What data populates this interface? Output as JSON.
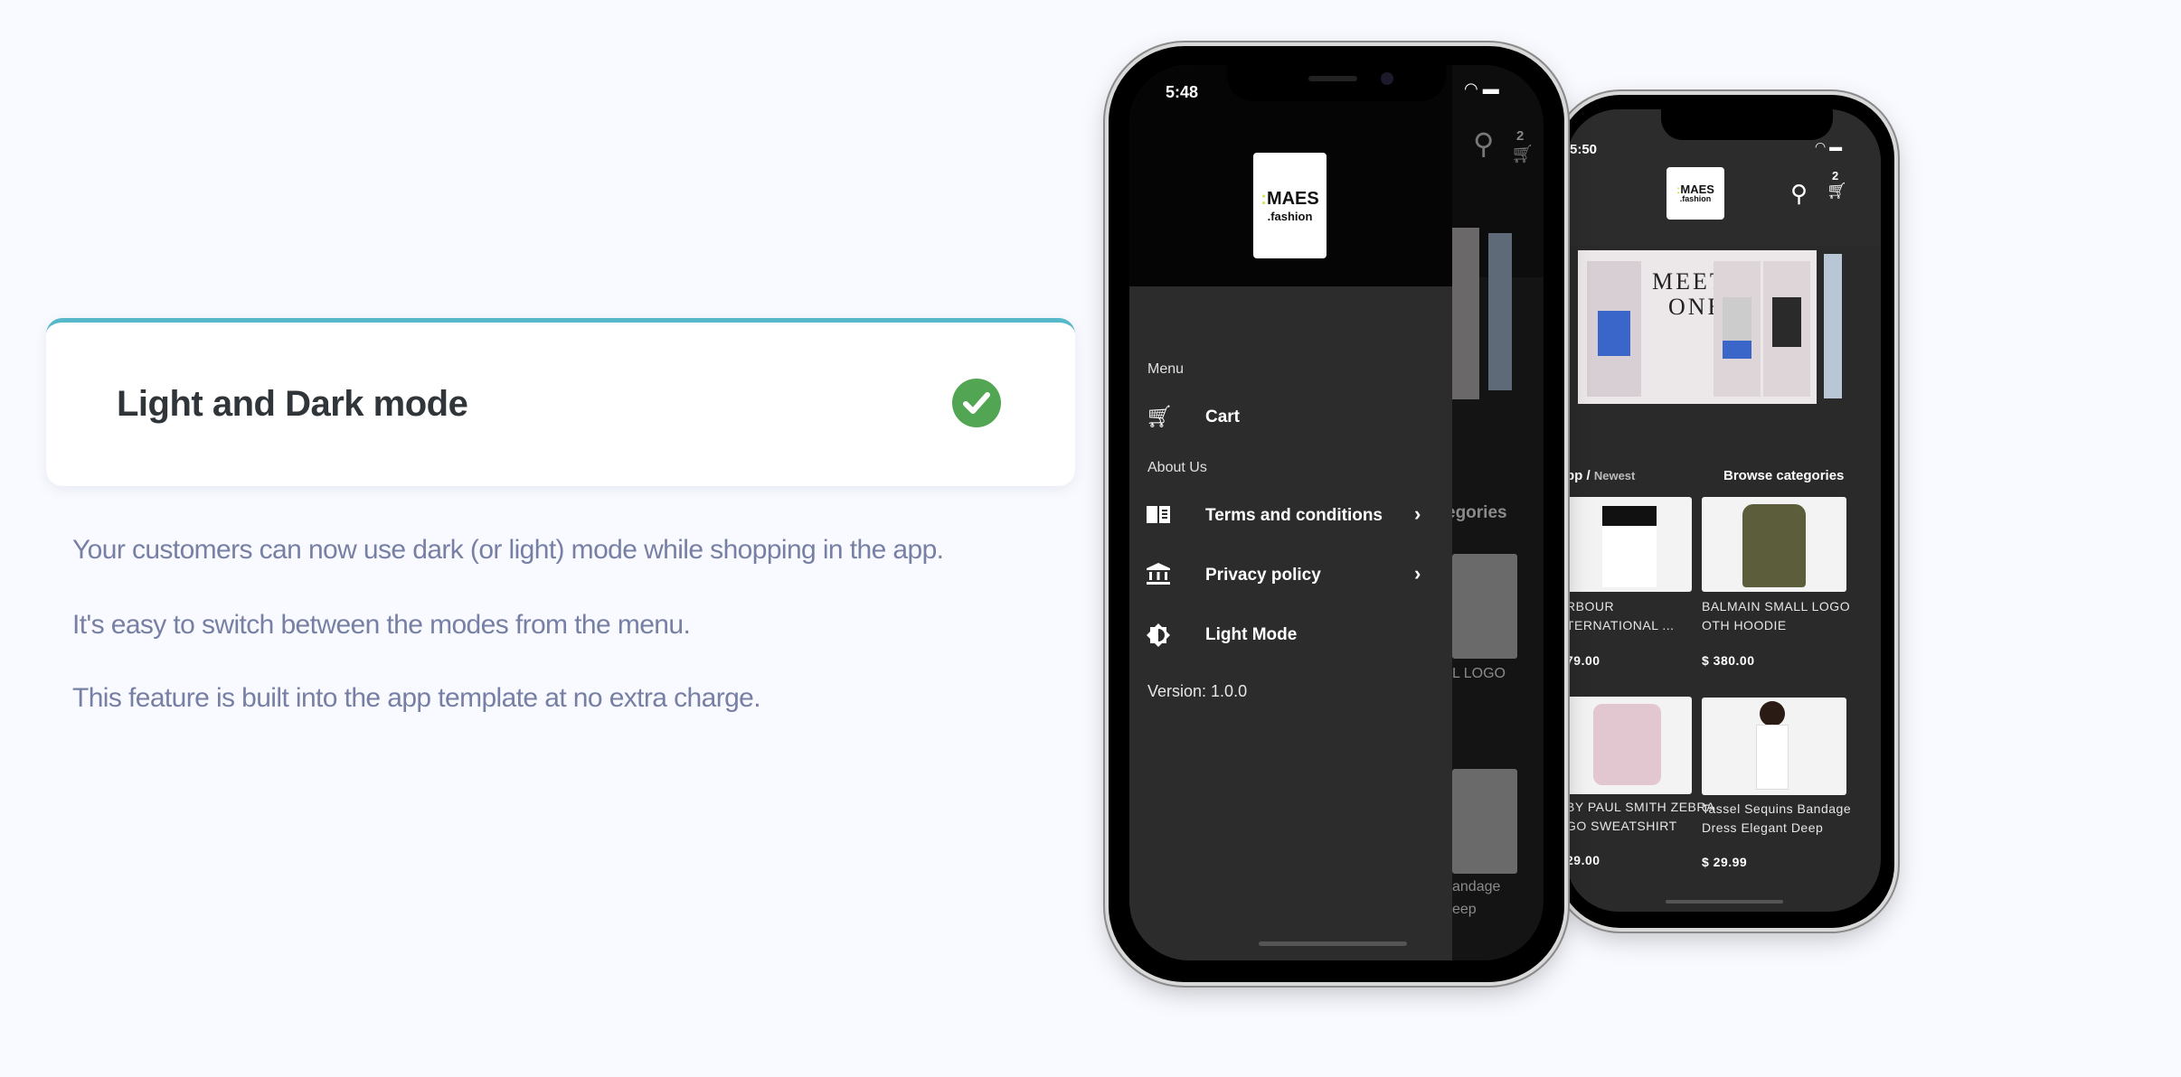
{
  "feature": {
    "title": "Light and Dark mode",
    "status_icon": "check-circle-icon",
    "accent_color": "#56b8c8",
    "check_color": "#52a552",
    "paragraphs": [
      "Your customers can now use dark (or light) mode while shopping in the app.",
      "It's easy to switch between the modes from the menu.",
      "This feature is built into the app template at no extra charge."
    ]
  },
  "front_phone": {
    "time": "5:48",
    "logo": {
      "line1": "MAES",
      "line2": ".fashion"
    },
    "menu": {
      "section_menu": "Menu",
      "cart": "Cart",
      "section_about": "About Us",
      "terms": "Terms and conditions",
      "privacy": "Privacy policy",
      "light_mode": "Light Mode",
      "version": "Version: 1.0.0"
    },
    "behind": {
      "cart_count": "2",
      "categories": "egories",
      "product1": "L LOGO",
      "product2_l1": "andage",
      "product2_l2": "eep"
    }
  },
  "back_phone": {
    "time": "5:50",
    "logo": {
      "line1": "MAES",
      "line2": ".fashion"
    },
    "cart_count": "2",
    "banner": {
      "headline1": "MEET",
      "headline2": "ONE"
    },
    "breadcrumb": {
      "prefix": "pp /",
      "current": "Newest"
    },
    "browse": "Browse categories",
    "products": [
      {
        "title_l1": "RBOUR",
        "title_l2": "TERNATIONAL ...",
        "price": "79.00"
      },
      {
        "title_l1": "BALMAIN SMALL LOGO",
        "title_l2": "OTH HOODIE",
        "price": "$ 380.00"
      },
      {
        "title_l1": " BY PAUL SMITH ZEBRA",
        "title_l2": "GO SWEATSHIRT",
        "price": "29.00"
      },
      {
        "title_l1": "Tassel Sequins Bandage",
        "title_l2": "Dress Elegant Deep",
        "price": "$ 29.99"
      }
    ]
  }
}
